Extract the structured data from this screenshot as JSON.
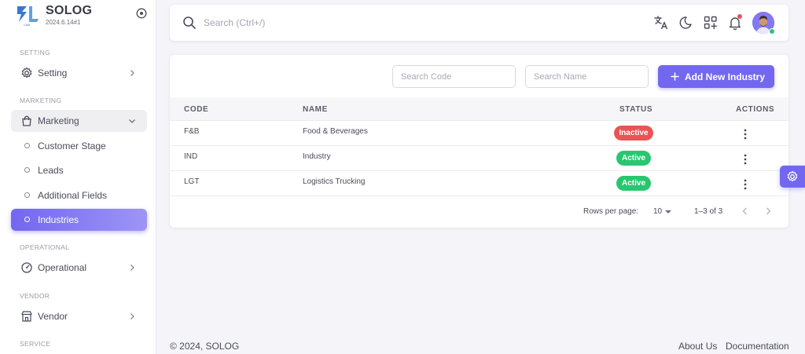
{
  "brand": {
    "name": "SOLOG",
    "version": "2024.6.14#1"
  },
  "sidebar": {
    "sections": [
      {
        "header": "SETTING",
        "items": [
          {
            "label": "Setting"
          }
        ]
      },
      {
        "header": "MARKETING",
        "items": [
          {
            "label": "Marketing"
          },
          {
            "label": "Customer Stage"
          },
          {
            "label": "Leads"
          },
          {
            "label": "Additional Fields"
          },
          {
            "label": "Industries"
          }
        ]
      },
      {
        "header": "OPERATIONAL",
        "items": [
          {
            "label": "Operational"
          }
        ]
      },
      {
        "header": "VENDOR",
        "items": [
          {
            "label": "Vendor"
          }
        ]
      },
      {
        "header": "SERVICE",
        "items": []
      }
    ]
  },
  "topbar": {
    "search_placeholder": "Search (Ctrl+/)"
  },
  "filters": {
    "code_placeholder": "Search Code",
    "name_placeholder": "Search Name"
  },
  "add_button_label": "Add New Industry",
  "table": {
    "columns": [
      "CODE",
      "NAME",
      "STATUS",
      "ACTIONS"
    ],
    "rows": [
      {
        "code": "F&B",
        "name": "Food & Beverages",
        "status": "Inactive"
      },
      {
        "code": "IND",
        "name": "Industry",
        "status": "Active"
      },
      {
        "code": "LGT",
        "name": "Logistics Trucking",
        "status": "Active"
      }
    ]
  },
  "pagination": {
    "rows_per_page_label": "Rows per page:",
    "rows_per_page": "10",
    "range": "1–3 of 3"
  },
  "footer": {
    "copyright": "© 2024, SOLOG",
    "links": [
      "About Us",
      "Documentation"
    ]
  },
  "colors": {
    "primary": "#7367f0",
    "success": "#28c76f",
    "danger": "#ea5455",
    "background": "#f5f5f9"
  },
  "icons": [
    "logo-icon",
    "collapse-icon",
    "gear-icon",
    "bag-icon",
    "gauge-icon",
    "store-icon",
    "search-icon",
    "translate-icon",
    "moon-icon",
    "grid-plus-icon",
    "bell-icon",
    "plus-icon",
    "kebab-icon",
    "chevron-left-icon",
    "chevron-right-icon"
  ]
}
